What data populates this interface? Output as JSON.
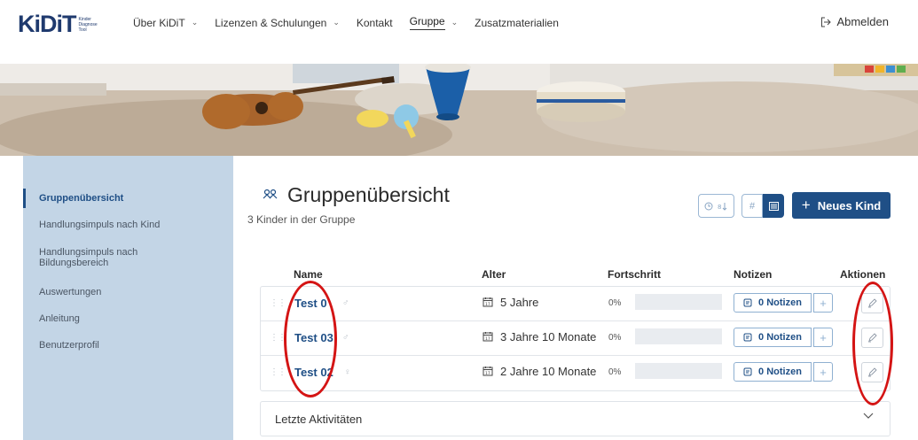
{
  "brand": {
    "logo": "KiDiT",
    "tagline": [
      "Kinder",
      "Diagnose",
      "Tool"
    ]
  },
  "nav": {
    "items": [
      {
        "label": "Über KiDiT",
        "dropdown": true
      },
      {
        "label": "Lizenzen & Schulungen",
        "dropdown": true
      },
      {
        "label": "Kontakt",
        "dropdown": false
      },
      {
        "label": "Gruppe",
        "dropdown": true,
        "active": true
      },
      {
        "label": "Zusatzmaterialien",
        "dropdown": false
      }
    ],
    "logout": "Abmelden"
  },
  "sidebar": {
    "items": [
      {
        "label": "Gruppenübersicht",
        "active": true
      },
      {
        "label": "Handlungsimpuls nach Kind"
      },
      {
        "label": "Handlungsimpuls nach Bildungsbereich"
      },
      {
        "label": "Auswertungen"
      },
      {
        "label": "Anleitung"
      },
      {
        "label": "Benutzerprofil"
      }
    ]
  },
  "main": {
    "title": "Gruppenübersicht",
    "subtitle": "3 Kinder in der Gruppe",
    "new_child_button": "Neues Kind",
    "table": {
      "headers": {
        "name": "Name",
        "age": "Alter",
        "progress": "Fortschritt",
        "notes": "Notizen",
        "actions": "Aktionen"
      },
      "rows": [
        {
          "name": "Test 0",
          "gender": "male",
          "age": "5 Jahre",
          "progress_label": "0%",
          "progress": 0,
          "notes": "0 Notizen"
        },
        {
          "name": "Test 03",
          "gender": "male",
          "age": "3 Jahre 10 Monate",
          "progress_label": "0%",
          "progress": 0,
          "notes": "0 Notizen"
        },
        {
          "name": "Test 02",
          "gender": "female",
          "age": "2 Jahre 10 Monate",
          "progress_label": "0%",
          "progress": 0,
          "notes": "0 Notizen"
        }
      ]
    },
    "activities": "Letzte Aktivitäten"
  },
  "colors": {
    "brand": "#1f4f86",
    "sidebar": "#c3d5e6",
    "annotation": "#d41414"
  }
}
